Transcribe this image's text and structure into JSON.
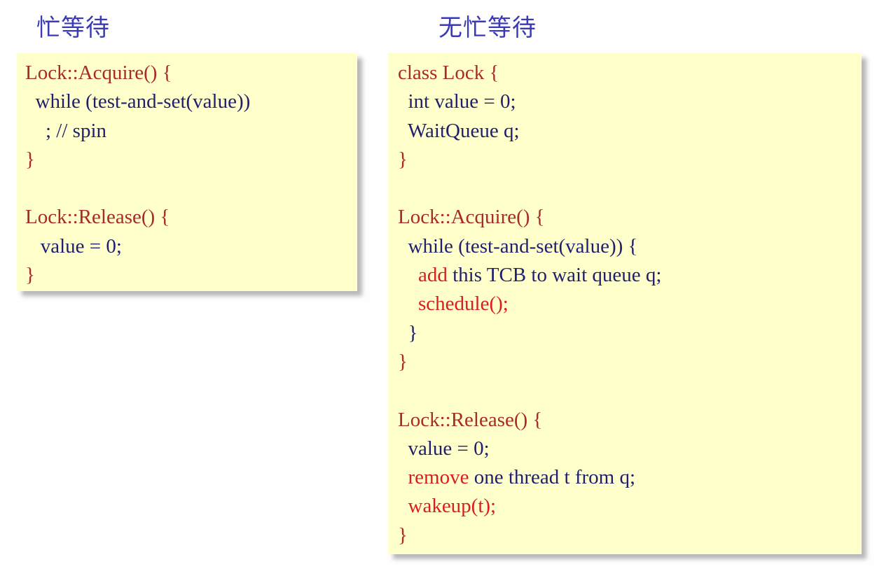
{
  "headings": {
    "busy_wait": "忙等待",
    "no_busy_wait": "无忙等待"
  },
  "colors": {
    "heading": "#3a3ab8",
    "box_background": "#ffffcc",
    "code_keyword_red": "#a82a2a",
    "code_highlight_red": "#d81e1e",
    "code_blue": "#1f1f6e"
  },
  "busy_wait_code": [
    [
      {
        "text": "Lock::Acquire() {",
        "color": "red"
      }
    ],
    [
      {
        "text": "  while (test-and-set(value))",
        "color": "blue"
      }
    ],
    [
      {
        "text": "    ; // spin",
        "color": "blue"
      }
    ],
    [
      {
        "text": "}",
        "color": "red"
      }
    ],
    [
      {
        "text": "",
        "color": "blue"
      }
    ],
    [
      {
        "text": "Lock::Release() {",
        "color": "red"
      }
    ],
    [
      {
        "text": "   value = 0;",
        "color": "blue"
      }
    ],
    [
      {
        "text": "}",
        "color": "red"
      }
    ]
  ],
  "no_busy_wait_code": [
    [
      {
        "text": "class Lock {",
        "color": "red"
      }
    ],
    [
      {
        "text": "  int value = 0;",
        "color": "blue"
      }
    ],
    [
      {
        "text": "  WaitQueue q;",
        "color": "blue"
      }
    ],
    [
      {
        "text": "}",
        "color": "red"
      }
    ],
    [
      {
        "text": "",
        "color": "blue"
      }
    ],
    [
      {
        "text": "Lock::Acquire() {",
        "color": "red"
      }
    ],
    [
      {
        "text": "  while (test-and-set(value)) {",
        "color": "blue"
      }
    ],
    [
      {
        "text": "    add",
        "color": "bright"
      },
      {
        "text": " this TCB to wait queue q;",
        "color": "blue"
      }
    ],
    [
      {
        "text": "    schedule();",
        "color": "bright"
      }
    ],
    [
      {
        "text": "  }",
        "color": "blue"
      }
    ],
    [
      {
        "text": "}",
        "color": "red"
      }
    ],
    [
      {
        "text": "",
        "color": "blue"
      }
    ],
    [
      {
        "text": "Lock::Release() {",
        "color": "red"
      }
    ],
    [
      {
        "text": "  value = 0;",
        "color": "blue"
      }
    ],
    [
      {
        "text": "  remove",
        "color": "bright"
      },
      {
        "text": " one thread t from q;",
        "color": "blue"
      }
    ],
    [
      {
        "text": "  wakeup(t);",
        "color": "bright"
      }
    ],
    [
      {
        "text": "}",
        "color": "red"
      }
    ]
  ]
}
